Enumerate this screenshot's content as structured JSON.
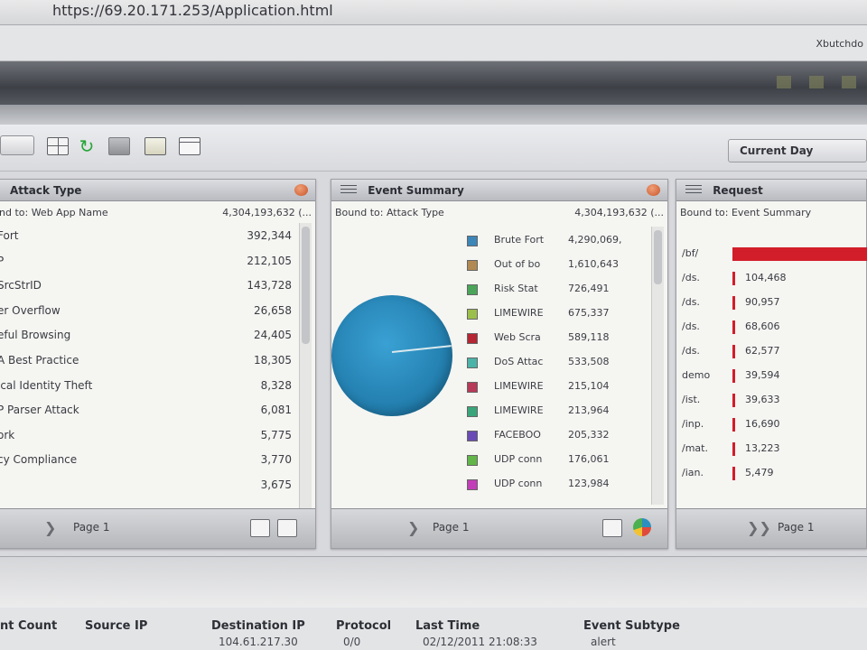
{
  "browser": {
    "url": "https://69.20.171.253/Application.html",
    "username": "Xbutchdo"
  },
  "toolbar": {
    "time_range": "Current Day"
  },
  "panels": {
    "attack_type": {
      "title": "Attack Type",
      "bound_to": "nd to: Web App Name",
      "total": "4,304,193,632 (...",
      "page": "Page 1",
      "rows": [
        {
          "label": "Fort",
          "value": "392,344"
        },
        {
          "label": "P",
          "value": "212,105"
        },
        {
          "label": "SrcStrID",
          "value": "143,728"
        },
        {
          "label": "er Overflow",
          "value": "26,658"
        },
        {
          "label": "eful Browsing",
          "value": "24,405"
        },
        {
          "label": "A Best Practice",
          "value": "18,305"
        },
        {
          "label": "ical Identity Theft",
          "value": "8,328"
        },
        {
          "label": "P Parser Attack",
          "value": "6,081"
        },
        {
          "label": "ork",
          "value": "5,775"
        },
        {
          "label": "cy Compliance",
          "value": "3,770"
        },
        {
          "label": "",
          "value": "3,675"
        }
      ]
    },
    "event_summary": {
      "title": "Event Summary",
      "bound_to": "Bound to: Attack Type",
      "total": "4,304,193,632 (...",
      "page": "Page 1",
      "legend": [
        {
          "label": "Brute Fort",
          "value": "4,290,069,",
          "color": "#3d86b8"
        },
        {
          "label": "Out of bo",
          "value": "1,610,643",
          "color": "#b08a52"
        },
        {
          "label": "Risk Stat",
          "value": "726,491",
          "color": "#4aa55a"
        },
        {
          "label": "LIMEWIRE",
          "value": "675,337",
          "color": "#9bbf4a"
        },
        {
          "label": "Web Scra",
          "value": "589,118",
          "color": "#b52532"
        },
        {
          "label": "DoS Attac",
          "value": "533,508",
          "color": "#4bb3a7"
        },
        {
          "label": "LIMEWIRE",
          "value": "215,104",
          "color": "#b83a5a"
        },
        {
          "label": "LIMEWIRE",
          "value": "213,964",
          "color": "#3aa57a"
        },
        {
          "label": "FACEBOO",
          "value": "205,332",
          "color": "#6a4bb5"
        },
        {
          "label": "UDP conn",
          "value": "176,061",
          "color": "#62b548"
        },
        {
          "label": "UDP conn",
          "value": "123,984",
          "color": "#c23eb8"
        }
      ]
    },
    "request": {
      "title": "Request",
      "bound_to": "Bound to: Event Summary",
      "page": "Page 1",
      "rows": [
        {
          "label": "/bf/",
          "value": "",
          "fraction": 1.0
        },
        {
          "label": "/ds.",
          "value": "104,468",
          "fraction": 0.02
        },
        {
          "label": "/ds.",
          "value": "90,957",
          "fraction": 0.02
        },
        {
          "label": "/ds.",
          "value": "68,606",
          "fraction": 0.02
        },
        {
          "label": "/ds.",
          "value": "62,577",
          "fraction": 0.02
        },
        {
          "label": "demo",
          "value": "39,594",
          "fraction": 0.02
        },
        {
          "label": "/ist.",
          "value": "39,633",
          "fraction": 0.02
        },
        {
          "label": "/inp.",
          "value": "16,690",
          "fraction": 0.02
        },
        {
          "label": "/mat.",
          "value": "13,223",
          "fraction": 0.02
        },
        {
          "label": "/ian.",
          "value": "5,479",
          "fraction": 0.02
        }
      ]
    }
  },
  "events_table": {
    "columns": [
      "nt Count",
      "Source IP",
      "Destination IP",
      "Protocol",
      "Last Time",
      "Event Subtype"
    ],
    "first_row": [
      "",
      "",
      "104.61.217.30",
      "0/0",
      "02/12/2011 21:08:33",
      "alert"
    ]
  }
}
